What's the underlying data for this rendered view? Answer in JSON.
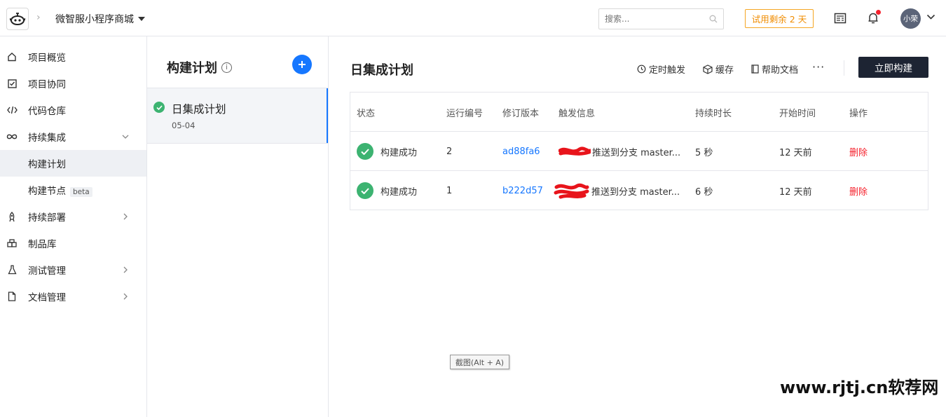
{
  "header": {
    "project_name": "微智服小程序商城",
    "search_placeholder": "搜索...",
    "trial_label": "试用剩余 2 天",
    "avatar_text": "小荣",
    "colors": {
      "trial": "#f08c00",
      "notification_dot": "#f5222d",
      "avatar_bg": "#5b6478"
    }
  },
  "sidebar": {
    "items": [
      {
        "label": "项目概览",
        "icon": "home-icon"
      },
      {
        "label": "项目协同",
        "icon": "checkbox-icon"
      },
      {
        "label": "代码仓库",
        "icon": "code-icon"
      },
      {
        "label": "持续集成",
        "icon": "infinity-icon",
        "expanded": true
      },
      {
        "label": "构建计划",
        "active": true
      },
      {
        "label": "构建节点",
        "badge": "beta"
      },
      {
        "label": "持续部署",
        "icon": "rocket-icon"
      },
      {
        "label": "制品库",
        "icon": "package-icon"
      },
      {
        "label": "测试管理",
        "icon": "flask-icon"
      },
      {
        "label": "文档管理",
        "icon": "document-icon"
      }
    ]
  },
  "plans": {
    "title": "构建计划",
    "items": [
      {
        "name": "日集成计划",
        "date": "05-04",
        "status": "success"
      }
    ]
  },
  "main": {
    "title": "日集成计划",
    "actions": {
      "timer": "定时触发",
      "cache": "缓存",
      "help": "帮助文档"
    },
    "build_button": "立即构建",
    "table": {
      "headers": [
        "状态",
        "运行编号",
        "修订版本",
        "触发信息",
        "持续时长",
        "开始时间",
        "操作"
      ],
      "rows": [
        {
          "status": "构建成功",
          "run": "2",
          "revision": "ad88fa6",
          "trigger": "推送到分支 master...",
          "duration": "5 秒",
          "start": "12 天前",
          "op": "删除"
        },
        {
          "status": "构建成功",
          "run": "1",
          "revision": "b222d57",
          "trigger": "推送到分支 master...",
          "duration": "6 秒",
          "start": "12 天前",
          "op": "删除"
        }
      ]
    },
    "colors": {
      "success": "#3cb371",
      "link": "#1677ff",
      "delete": "#f5222d",
      "build_button_bg": "#1d2433"
    }
  },
  "overlay": {
    "tooltip": "截图(Alt + A)",
    "watermark": "www.rjtj.cn软荐网"
  }
}
